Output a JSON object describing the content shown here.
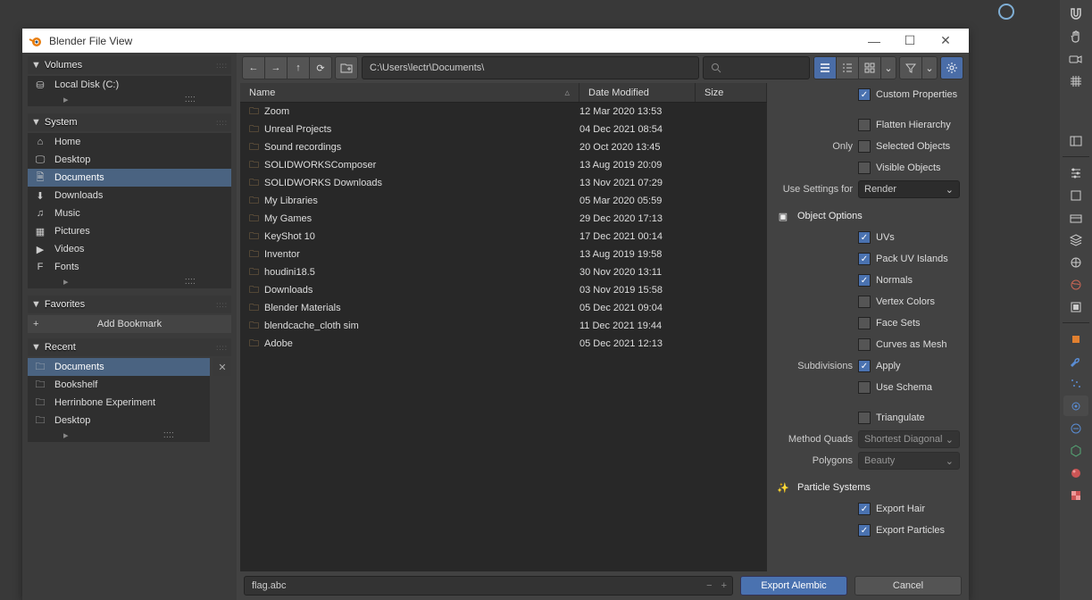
{
  "dialog": {
    "title": "Blender File View",
    "path": "C:\\Users\\lectr\\Documents\\",
    "filename": "flag.abc",
    "export_button": "Export Alembic",
    "cancel_button": "Cancel"
  },
  "sidebar": {
    "volumes_header": "Volumes",
    "volumes": [
      {
        "label": "Local Disk (C:)",
        "icon": "disk"
      }
    ],
    "system_header": "System",
    "system": [
      {
        "label": "Home",
        "icon": "home"
      },
      {
        "label": "Desktop",
        "icon": "desktop"
      },
      {
        "label": "Documents",
        "icon": "docs",
        "selected": true
      },
      {
        "label": "Downloads",
        "icon": "down"
      },
      {
        "label": "Music",
        "icon": "music"
      },
      {
        "label": "Pictures",
        "icon": "pic"
      },
      {
        "label": "Videos",
        "icon": "vid"
      },
      {
        "label": "Fonts",
        "icon": "font"
      }
    ],
    "favorites_header": "Favorites",
    "add_bookmark": "Add Bookmark",
    "recent_header": "Recent",
    "recent": [
      {
        "label": "Documents",
        "icon": "folder",
        "selected": true
      },
      {
        "label": "Bookshelf",
        "icon": "folder"
      },
      {
        "label": "Herrinbone Experiment",
        "icon": "folder"
      },
      {
        "label": "Desktop",
        "icon": "folder"
      }
    ]
  },
  "columns": {
    "name": "Name",
    "date": "Date Modified",
    "size": "Size"
  },
  "files": [
    {
      "name": "Zoom",
      "date": "12 Mar 2020 13:53"
    },
    {
      "name": "Unreal Projects",
      "date": "04 Dec 2021 08:54"
    },
    {
      "name": "Sound recordings",
      "date": "20 Oct 2020 13:45"
    },
    {
      "name": "SOLIDWORKSComposer",
      "date": "13 Aug 2019 20:09"
    },
    {
      "name": "SOLIDWORKS Downloads",
      "date": "13 Nov 2021 07:29"
    },
    {
      "name": "My Libraries",
      "date": "05 Mar 2020 05:59"
    },
    {
      "name": "My Games",
      "date": "29 Dec 2020 17:13"
    },
    {
      "name": "KeyShot 10",
      "date": "17 Dec 2021 00:14"
    },
    {
      "name": "Inventor",
      "date": "13 Aug 2019 19:58"
    },
    {
      "name": "houdini18.5",
      "date": "30 Nov 2020 13:11"
    },
    {
      "name": "Downloads",
      "date": "03 Nov 2019 15:58"
    },
    {
      "name": "Blender Materials",
      "date": "05 Dec 2021 09:04"
    },
    {
      "name": "blendcache_cloth sim",
      "date": "11 Dec 2021 19:44"
    },
    {
      "name": "Adobe",
      "date": "05 Dec 2021 12:13"
    }
  ],
  "options": {
    "custom_properties": "Custom Properties",
    "flatten_hierarchy": "Flatten Hierarchy",
    "only_label": "Only",
    "selected_objects": "Selected Objects",
    "visible_objects": "Visible Objects",
    "use_settings_label": "Use Settings for",
    "use_settings_value": "Render",
    "object_options_header": "Object Options",
    "uvs": "UVs",
    "pack_uv": "Pack UV Islands",
    "normals": "Normals",
    "vertex_colors": "Vertex Colors",
    "face_sets": "Face Sets",
    "curves_as_mesh": "Curves as Mesh",
    "subdivisions_label": "Subdivisions",
    "apply": "Apply",
    "use_schema": "Use Schema",
    "triangulate": "Triangulate",
    "method_quads_label": "Method Quads",
    "method_quads_value": "Shortest Diagonal",
    "polygons_label": "Polygons",
    "polygons_value": "Beauty",
    "particle_header": "Particle Systems",
    "export_hair": "Export Hair",
    "export_particles": "Export Particles"
  }
}
